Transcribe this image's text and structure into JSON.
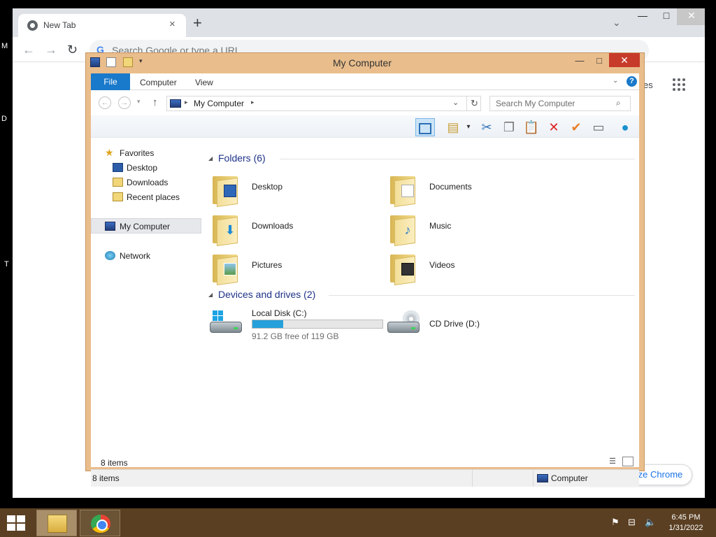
{
  "edge_letters": [
    "M",
    "D",
    "T"
  ],
  "chrome": {
    "tab": {
      "title": "New Tab",
      "close_glyph": "×"
    },
    "new_tab_glyph": "+",
    "tab_search_glyph": "⌄",
    "window_controls": {
      "minimize": "—",
      "maximize": "□",
      "close": "✕"
    },
    "nav": {
      "back": "←",
      "forward": "→",
      "reload": "↻"
    },
    "omnibox": {
      "placeholder": "Search Google or type a URL",
      "g_letter": "G"
    },
    "right_edge_text": "es",
    "customize_label": "Customize Chrome"
  },
  "explorer": {
    "title": "My Computer",
    "window_controls": {
      "minimize": "—",
      "maximize": "□",
      "close": "✕"
    },
    "ribbon": {
      "file": "File",
      "tabs": [
        "Computer",
        "View"
      ],
      "expand_glyph": "⌄",
      "help_glyph": "?"
    },
    "address": {
      "segment": "My Computer",
      "arrow": "▸",
      "dropdown_glyph": "⌄",
      "refresh_glyph": "↻"
    },
    "search": {
      "placeholder": "Search My Computer",
      "icon": "⌕"
    },
    "nav_glyphs": {
      "back": "←",
      "forward": "→",
      "recent": "▾",
      "up": "↑"
    },
    "navpane": {
      "favorites": "Favorites",
      "favorites_items": [
        "Desktop",
        "Downloads",
        "Recent places"
      ],
      "my_computer": "My Computer",
      "network": "Network"
    },
    "folders_header": "Folders (6)",
    "folders": [
      "Desktop",
      "Documents",
      "Downloads",
      "Music",
      "Pictures",
      "Videos"
    ],
    "drives_header": "Devices and drives (2)",
    "drives": [
      {
        "name": "Local Disk (C:)",
        "free_text": "91.2 GB free of 119 GB",
        "used_fraction": 0.234
      },
      {
        "name": "CD Drive (D:)"
      }
    ],
    "items_count": "8 items",
    "status": {
      "left": "8 items",
      "right": "Computer"
    }
  },
  "taskbar": {
    "time": "6:45 PM",
    "date": "1/31/2022"
  },
  "colors": {
    "window_frame": "#e9bd8c",
    "close_red": "#c73b2b",
    "ribbon_blue": "#1979ca",
    "group_header": "#1e3287",
    "drive_bar": "#26a0da",
    "taskbar": "#5a3f22"
  }
}
